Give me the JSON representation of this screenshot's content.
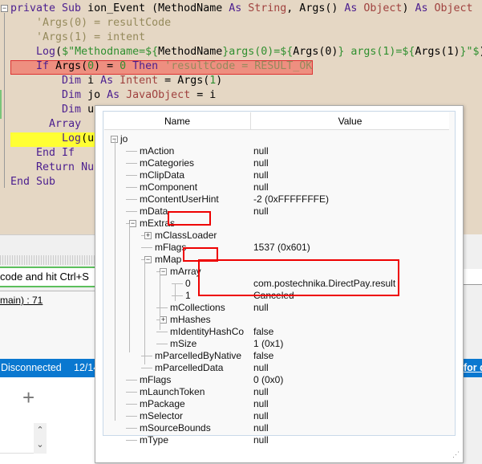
{
  "code": {
    "lines": [
      [
        [
          "kw",
          "private Sub "
        ],
        [
          "",
          "ion_Event"
        ],
        [
          "",
          " (MethodName "
        ],
        [
          "kw",
          "As "
        ],
        [
          "ty",
          "String"
        ],
        [
          "",
          ", Args() "
        ],
        [
          "kw",
          "As "
        ],
        [
          "ty",
          "Object"
        ],
        [
          "",
          ") "
        ],
        [
          "kw",
          "As "
        ],
        [
          "ty",
          "Object"
        ]
      ],
      [
        [
          "",
          "    "
        ],
        [
          "cm",
          "'Args(0) = resultCode"
        ]
      ],
      [
        [
          "",
          "    "
        ],
        [
          "cm",
          "'Args(1) = intent"
        ]
      ],
      [
        [
          "",
          "    "
        ],
        [
          "kw",
          "Log"
        ],
        [
          "",
          "("
        ],
        [
          "st",
          "$\"Methodname=${"
        ],
        [
          "",
          "MethodName"
        ],
        [
          "st",
          "}args(0)=${"
        ],
        [
          "",
          "Args(0)"
        ],
        [
          "st",
          "} args(1)=${"
        ],
        [
          "",
          "Args(1)"
        ],
        [
          "st",
          "}\"$"
        ],
        [
          "",
          ")"
        ]
      ],
      [
        [
          "",
          "    "
        ],
        [
          "kw",
          "If "
        ],
        [
          "",
          "Args("
        ],
        [
          "nm",
          "0"
        ],
        [
          "",
          ") = "
        ],
        [
          "nm",
          "0 "
        ],
        [
          "kw",
          "Then "
        ],
        [
          "cm",
          "'resultCode = RESULT_OK"
        ]
      ],
      [
        [
          "",
          "        "
        ],
        [
          "kw",
          "Dim "
        ],
        [
          "",
          "i "
        ],
        [
          "kw",
          "As "
        ],
        [
          "ty",
          "Intent"
        ],
        [
          "",
          " = Args("
        ],
        [
          "nm",
          "1"
        ],
        [
          "",
          ")"
        ]
      ],
      [
        [
          "",
          "        "
        ],
        [
          "kw",
          "Dim "
        ],
        [
          "",
          "jo "
        ],
        [
          "kw",
          "As "
        ],
        [
          "ty",
          "JavaObject"
        ],
        [
          "",
          " = i"
        ]
      ],
      [
        [
          "",
          "        "
        ],
        [
          "kw",
          "Dim "
        ],
        [
          "",
          "u"
        ]
      ],
      [
        [
          "",
          "      "
        ],
        [
          "kw",
          "Array"
        ]
      ],
      [
        [
          "",
          "        "
        ],
        [
          "kw",
          "Log"
        ],
        [
          "",
          "(u"
        ]
      ],
      [
        [
          "",
          "    "
        ],
        [
          "kw",
          "End If"
        ]
      ],
      [
        [
          "",
          "    "
        ],
        [
          "kw",
          "Return "
        ],
        [
          "kw",
          "Nu"
        ]
      ],
      [
        [
          "kw",
          "End Sub"
        ]
      ]
    ]
  },
  "ide": {
    "hint": "code and hit Ctrl+S",
    "link": "main) : 71",
    "status_left": "Disconnected",
    "status_mid": "12/14",
    "status_right": "for de",
    "add": "+",
    "up": "⌃",
    "down": "⌄"
  },
  "watch": {
    "col_name": "Name",
    "col_value": "Value",
    "rows": [
      {
        "name": "jo",
        "value": "",
        "level": 0,
        "exp": "−"
      },
      {
        "name": "mAction",
        "value": "null",
        "level": 1
      },
      {
        "name": "mCategories",
        "value": "null",
        "level": 1
      },
      {
        "name": "mClipData",
        "value": "null",
        "level": 1
      },
      {
        "name": "mComponent",
        "value": "null",
        "level": 1
      },
      {
        "name": "mContentUserHint",
        "value": "-2 (0xFFFFFFFE)",
        "level": 1
      },
      {
        "name": "mData",
        "value": "null",
        "level": 1
      },
      {
        "name": "mExtras",
        "value": "",
        "level": 1,
        "exp": "−",
        "hl": true
      },
      {
        "name": "mClassLoader",
        "value": "",
        "level": 2,
        "exp": "+"
      },
      {
        "name": "mFlags",
        "value": "1537 (0x601)",
        "level": 2
      },
      {
        "name": "mMap",
        "value": "",
        "level": 2,
        "exp": "−",
        "hl": true
      },
      {
        "name": "mArray",
        "value": "",
        "level": 3,
        "exp": "−"
      },
      {
        "name": "0",
        "value": "com.postechnika.DirectPay.result",
        "level": 4
      },
      {
        "name": "1",
        "value": "Canceled",
        "level": 4
      },
      {
        "name": "mCollections",
        "value": "null",
        "level": 3
      },
      {
        "name": "mHashes",
        "value": "",
        "level": 3,
        "exp": "+"
      },
      {
        "name": "mIdentityHashCo",
        "value": "false",
        "level": 3
      },
      {
        "name": "mSize",
        "value": "1 (0x1)",
        "level": 3
      },
      {
        "name": "mParcelledByNative",
        "value": "false",
        "level": 2
      },
      {
        "name": "mParcelledData",
        "value": "null",
        "level": 2
      },
      {
        "name": "mFlags",
        "value": "0 (0x0)",
        "level": 1
      },
      {
        "name": "mLaunchToken",
        "value": "null",
        "level": 1
      },
      {
        "name": "mPackage",
        "value": "null",
        "level": 1
      },
      {
        "name": "mSelector",
        "value": "null",
        "level": 1
      },
      {
        "name": "mSourceBounds",
        "value": "null",
        "level": 1
      },
      {
        "name": "mType",
        "value": "null",
        "level": 1
      }
    ]
  }
}
